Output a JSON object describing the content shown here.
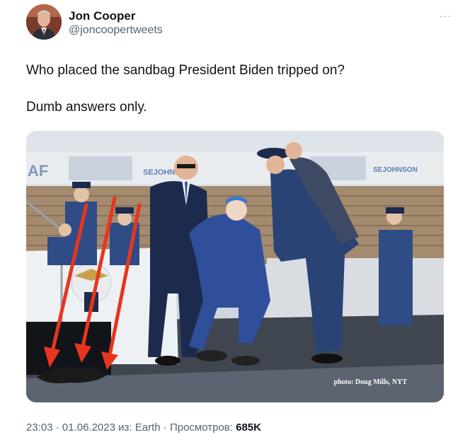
{
  "author": {
    "name": "Jon Cooper",
    "handle": "@joncoopertweets"
  },
  "more_icon": "more-options-icon",
  "tweet": {
    "line1": "Who placed the sandbag President Biden tripped on?",
    "line2": "Dumb answers only."
  },
  "photo": {
    "credit": "photo: Doug Mills, NYT",
    "banner_text_1": "AF",
    "banner_text_2": "SEJOHNSON",
    "banner_text_3": "SEJOHNSON"
  },
  "meta": {
    "time": "23:03",
    "date": "01.06.2023",
    "source_prefix": "из:",
    "source": "Earth",
    "views_label": "Просмотров:",
    "views_count": "685K"
  },
  "colors": {
    "arrow": "#e8351f",
    "uniform_blue": "#2f4c86",
    "suit_navy": "#1c2b4d"
  }
}
